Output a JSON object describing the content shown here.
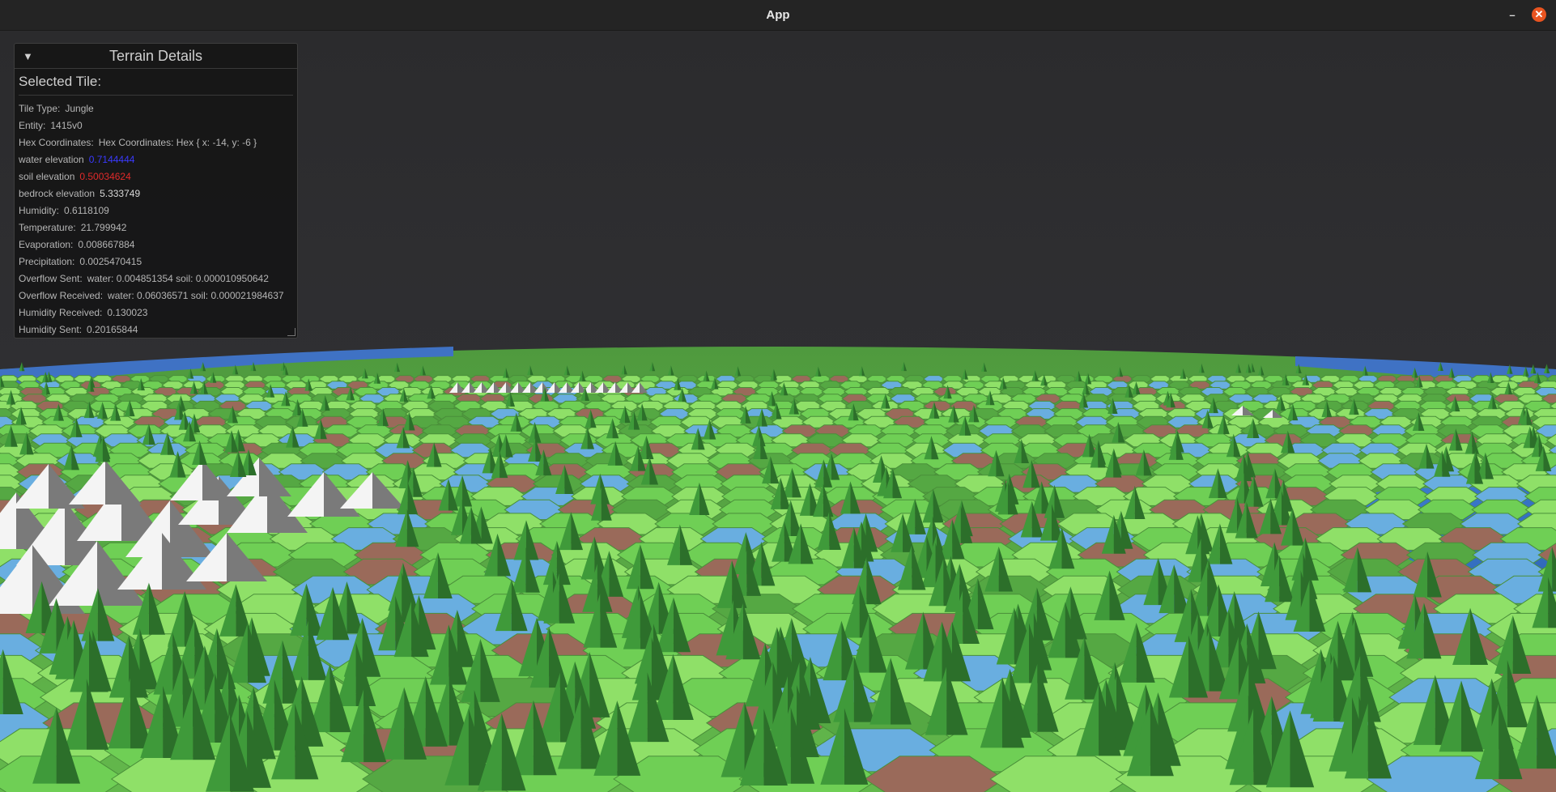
{
  "window": {
    "title": "App",
    "minimize_icon": "minimize-icon",
    "close_icon": "close-icon"
  },
  "panel": {
    "title": "Terrain Details",
    "collapse_icon": "triangle-down-icon",
    "section": "Selected Tile:",
    "rows": [
      {
        "label": "Tile Type:",
        "value": "Jungle"
      },
      {
        "label": "Entity:",
        "value": "1415v0"
      },
      {
        "label": "Hex Coordinates:",
        "value": "Hex Coordinates: Hex { x: -14, y: -6 }"
      },
      {
        "label": "water elevation",
        "value": "0.7144444"
      },
      {
        "label": "soil elevation",
        "value": "0.50034624"
      },
      {
        "label": "bedrock elevation",
        "value": "5.333749"
      },
      {
        "label": "Humidity:",
        "value": "0.6118109"
      },
      {
        "label": "Temperature:",
        "value": "21.799942"
      },
      {
        "label": "Evaporation:",
        "value": "0.008667884"
      },
      {
        "label": "Precipitation:",
        "value": "0.0025470415"
      },
      {
        "label": "Overflow Sent:",
        "value": "water: 0.004851354 soil: 0.000010950642"
      },
      {
        "label": "Overflow Received:",
        "value": "water: 0.06036571 soil: 0.000021984637"
      },
      {
        "label": "Humidity Received:",
        "value": "0.130023"
      },
      {
        "label": "Humidity Sent:",
        "value": "0.20165844"
      }
    ]
  },
  "colors": {
    "sky": "#2d2d30",
    "grass_light": "#8fe068",
    "grass": "#6fcf55",
    "grass_dark": "#55a843",
    "water": "#69aee0",
    "water_dark": "#3f7fc9",
    "soil": "#9a6a5a",
    "tree": "#3f9a3a",
    "tree_dark": "#2c6f2a",
    "snow": "#f4f4f4",
    "rock": "#7a7a7a",
    "value_blue": "#3a3aff",
    "value_red": "#e02a2a"
  }
}
